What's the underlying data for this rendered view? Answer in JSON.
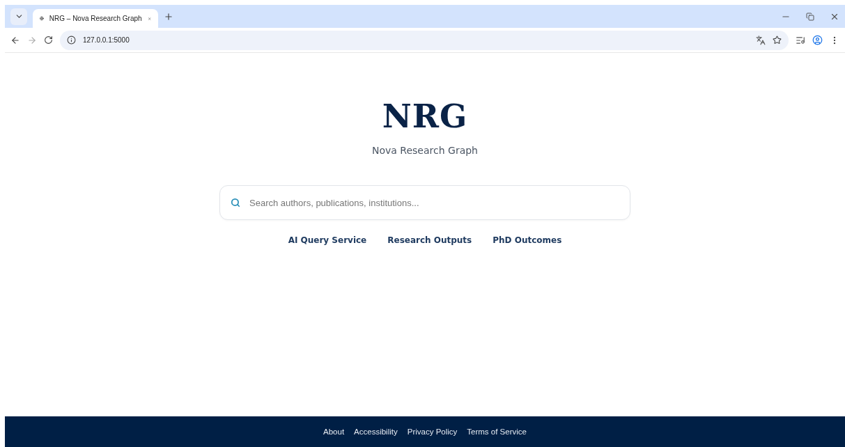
{
  "browser": {
    "tabs": [
      {
        "title": "NRG – Nova Research Graph",
        "selected": true
      }
    ],
    "address": "127.0.0.1:5000"
  },
  "hero": {
    "logo": "NRG",
    "subtitle": "Nova Research Graph"
  },
  "search": {
    "placeholder": "Search authors, publications, institutions..."
  },
  "links": [
    "AI Query Service",
    "Research Outputs",
    "PhD Outcomes"
  ],
  "footer": {
    "links": [
      "About",
      "Accessibility",
      "Privacy Policy",
      "Terms of Service"
    ]
  }
}
